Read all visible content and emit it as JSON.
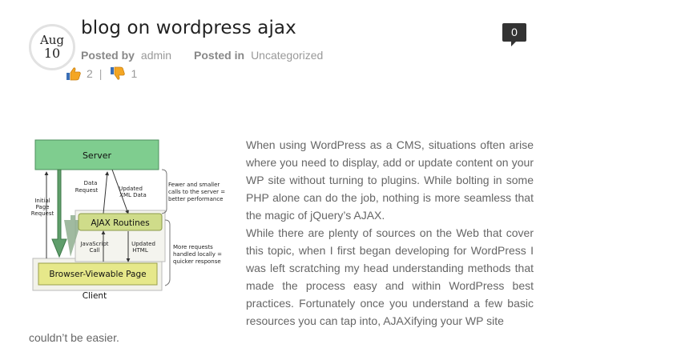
{
  "post": {
    "date": {
      "month": "Aug",
      "day": "10"
    },
    "title": "blog on wordpress ajax",
    "meta": {
      "posted_by_label": "Posted by",
      "author": "admin",
      "posted_in_label": "Posted in",
      "category": "Uncategorized"
    },
    "votes": {
      "up": "2",
      "separator": "|",
      "down": "1"
    },
    "comment_count": "0",
    "body": {
      "paragraph1": "When using WordPress as a CMS, situations often arise where you need to display, add or update content on your WP site without turning to plugins. While bolting in some PHP alone can do the job, nothing is more seamless that the magic of jQuery’s AJAX.",
      "paragraph2": "While there are plenty of sources on the Web that cover this topic, when I first began developing for WordPress I was left scratching my head understanding methods that made the process easy and within WordPress best practices. Fortunately once you understand a few basic resources you can tap into, AJAXifying your WP site",
      "tail": "couldn’t be easier."
    }
  },
  "diagram": {
    "server": "Server",
    "ajax_routines": "AJAX Routines",
    "browser_page": "Browser-Viewable Page",
    "client": "Client",
    "initial_request": [
      "Initial",
      "Page",
      "Request"
    ],
    "data_request": [
      "Data",
      "Request"
    ],
    "updated_xml": [
      "Updated",
      "XML Data"
    ],
    "javascript_call": [
      "JavaScript",
      "Call"
    ],
    "updated_html": [
      "Updated",
      "HTML"
    ],
    "note_fewer": [
      "Fewer and smaller",
      "calls to the server =",
      "better performance"
    ],
    "note_more": [
      "More requests",
      "handled locally =",
      "quicker response"
    ],
    "colors": {
      "server_fill": "#7fcd8f",
      "ajax_fill": "#cfdc8a",
      "page_fill": "#e6e88a",
      "arrow_green": "#5f9e6b"
    }
  }
}
